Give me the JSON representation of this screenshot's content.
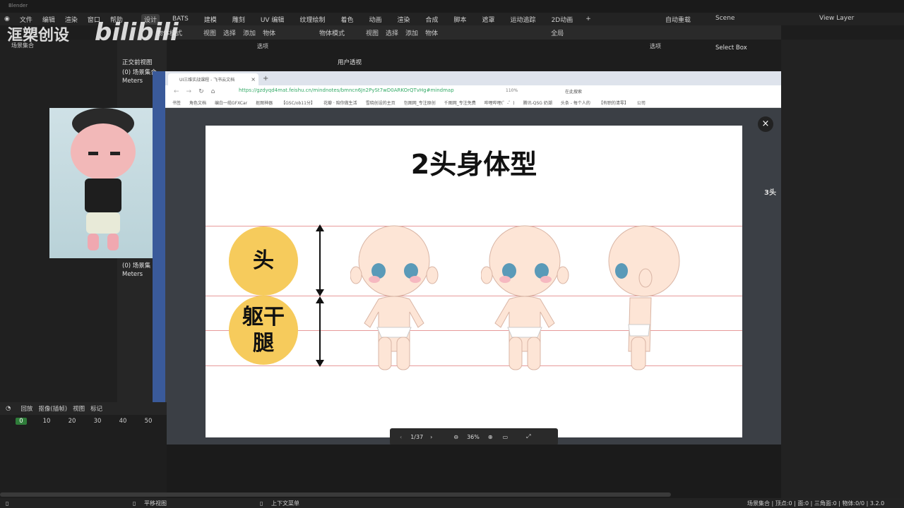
{
  "window": {
    "title": "Blender"
  },
  "menubar": {
    "items": [
      "文件",
      "编辑",
      "渲染",
      "窗口",
      "帮助"
    ],
    "workspaces": [
      "设计",
      "BATS",
      "建模",
      "雕刻",
      "UV 编辑",
      "纹理绘制",
      "着色",
      "动画",
      "渲染",
      "合成",
      "脚本",
      "遮罩",
      "运动追踪",
      "2D动画"
    ],
    "add": "+",
    "right": {
      "autokey": "自动重载",
      "scene": "Scene",
      "view_layer": "View Layer"
    }
  },
  "watermark": {
    "logo": "洭槊创设",
    "site": "bilibili"
  },
  "viewport_left": {
    "header": [
      "物体模式",
      "视图",
      "选择",
      "添加",
      "物体"
    ],
    "label_view": "正交前视图",
    "label_collection": "(0) 场景集合",
    "label_units": "Meters",
    "label_collection2": "(0) 场景集",
    "label_units2": "Meters",
    "outliner_item": "场景集合",
    "options": "选项"
  },
  "viewport_right": {
    "header": [
      "物体模式",
      "视图",
      "选择",
      "添加",
      "物体"
    ],
    "global": "全局",
    "label_view": "用户透视",
    "label_collection": "(0) 场景集合",
    "options": "选项",
    "select_box": "Select Box"
  },
  "timeline": {
    "header": [
      "回放",
      "抠像(插帧)",
      "视图",
      "标记"
    ],
    "frames": [
      "0",
      "10",
      "20",
      "30",
      "40",
      "50"
    ]
  },
  "browser": {
    "tab_title": "UI三维实战课程 - 飞书云文档",
    "url": "https://gzdyqd4mat.feishu.cn/mindnotes/bmncn6Jn2PySt7wD0ARKOrQTvHg#mindmap",
    "zoom": "110%",
    "search_placeholder": "在此搜索",
    "bookmarks": [
      "书签",
      "角色文档",
      "编白一缆GFXCar",
      "抠图神器",
      "【GSC/ob11分】",
      "花瓣 · 陪你做生活",
      "雪晓创设的主页",
      "包图网_专注原创",
      "千图网_专注免费",
      "哔哩哔哩(゜-゜)",
      "腾讯-QSG 奶潮",
      "头条 - 每个人的",
      "【有职的清零】",
      "公司"
    ]
  },
  "slide": {
    "title": "2头身体型",
    "labels": {
      "head": "头",
      "torso": "躯干",
      "leg": "腿"
    },
    "side_text": "3头"
  },
  "viewer_toolbar": {
    "page": "1/37",
    "zoom": "36%"
  },
  "statusbar": {
    "pan": "平移视图",
    "context_menu": "上下文菜单",
    "stats": "场景集合 | 顶点:0 | 面:0 | 三角面:0 | 物体:0/0 | 3.2.0"
  },
  "colors": {
    "accent_circle": "#f6cb5c",
    "guide_line": "#e79a9a",
    "blender_bg": "#1d1d1d"
  }
}
